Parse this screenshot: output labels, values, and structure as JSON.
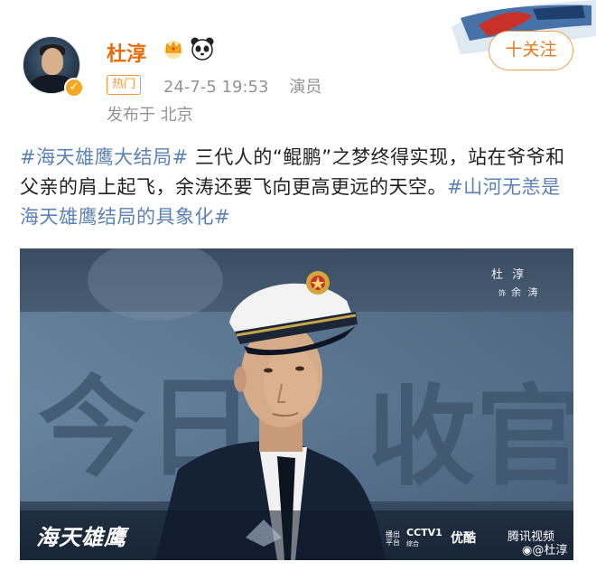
{
  "post": {
    "author": "杜淳",
    "hot_tag": "热门",
    "timestamp": "24-7-5 19:53",
    "role": "演员",
    "location": "发布于 北京",
    "follow_label": "十关注",
    "hashtag1": "#海天雄鹰大结局#",
    "body1": " 三代人的“鲲鹏”之梦终得实现，站在爷爷和父亲的肩上起飞，余涛还要飞向更高更远的天空。",
    "hashtag2": "#山河无恙是海天雄鹰结局的具象化#"
  },
  "poster": {
    "actor_name": "杜 淳",
    "role_prefix": "饰",
    "role_name": "余 涛",
    "big_text_left": "今日",
    "big_text_right": "收官",
    "drama_title": "海天雄鹰",
    "platform_label": "播出平台",
    "channel": "CCTV1",
    "channel_sub": "综合",
    "platform_youku": "优酷",
    "platform_tencent": "腾讯视频",
    "watermark": "@杜淳"
  },
  "colors": {
    "username": "#e86b0a",
    "hashtag": "#5b82b6",
    "meta_gray": "#939393",
    "follow_border": "#f0a04b"
  },
  "icons": [
    "crown-icon",
    "panda-icon",
    "verified-badge-icon",
    "navy-emblem-icon",
    "weibo-logo-icon"
  ]
}
